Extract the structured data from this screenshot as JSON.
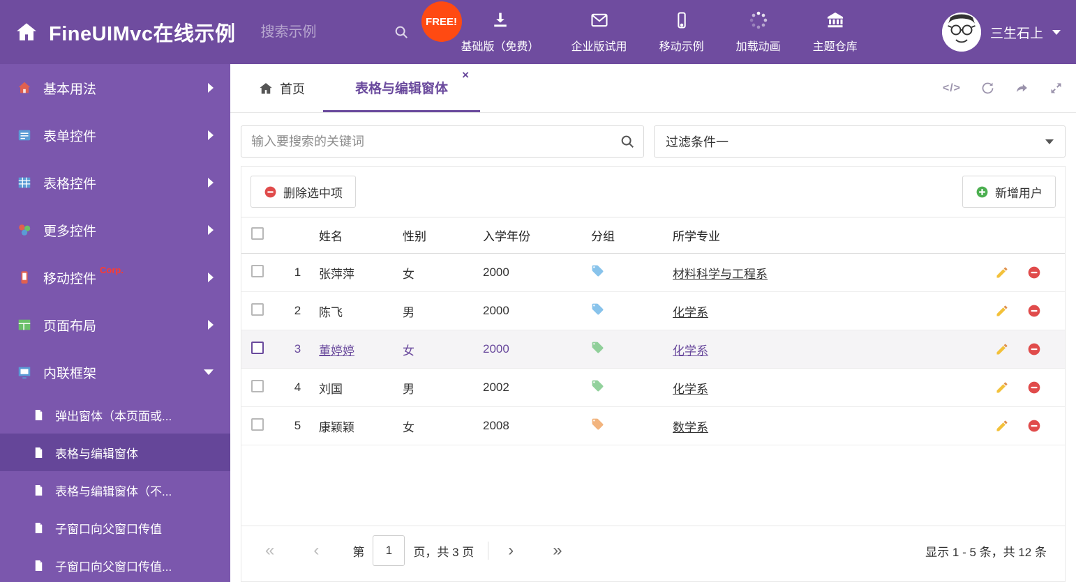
{
  "header": {
    "title": "FineUIMvc在线示例",
    "search_placeholder": "搜索示例",
    "free_badge": "FREE!",
    "nav": [
      {
        "icon": "download-icon",
        "label": "基础版（免费）"
      },
      {
        "icon": "envelope-icon",
        "label": "企业版试用"
      },
      {
        "icon": "mobile-icon",
        "label": "移动示例"
      },
      {
        "icon": "spinner-icon",
        "label": "加载动画"
      },
      {
        "icon": "bank-icon",
        "label": "主题仓库"
      }
    ],
    "user": "三生石上"
  },
  "sidebar": {
    "items": [
      {
        "label": "基本用法"
      },
      {
        "label": "表单控件"
      },
      {
        "label": "表格控件"
      },
      {
        "label": "更多控件"
      },
      {
        "label": "移动控件",
        "badge": "Corp."
      },
      {
        "label": "页面布局"
      },
      {
        "label": "内联框架",
        "expanded": true
      }
    ],
    "subitems": [
      {
        "label": "弹出窗体（本页面或..."
      },
      {
        "label": "表格与编辑窗体",
        "active": true
      },
      {
        "label": "表格与编辑窗体（不..."
      },
      {
        "label": "子窗口向父窗口传值"
      },
      {
        "label": "子窗口向父窗口传值..."
      }
    ]
  },
  "tabs": {
    "home": "首页",
    "active": "表格与编辑窗体"
  },
  "filters": {
    "search_placeholder": "输入要搜索的关键词",
    "dropdown_value": "过滤条件一"
  },
  "toolbar": {
    "delete_label": "删除选中项",
    "add_label": "新增用户"
  },
  "table": {
    "columns": [
      "姓名",
      "性别",
      "入学年份",
      "分组",
      "所学专业"
    ],
    "rows": [
      {
        "num": "1",
        "name": "张萍萍",
        "gender": "女",
        "year": "2000",
        "tag_color": "#74b9e8",
        "major": "材料科学与工程系"
      },
      {
        "num": "2",
        "name": "陈飞",
        "gender": "男",
        "year": "2000",
        "tag_color": "#74b9e8",
        "major": "化学系"
      },
      {
        "num": "3",
        "name": "董婷婷",
        "gender": "女",
        "year": "2000",
        "tag_color": "#7fc98b",
        "major": "化学系",
        "selected": true
      },
      {
        "num": "4",
        "name": "刘国",
        "gender": "男",
        "year": "2002",
        "tag_color": "#7fc98b",
        "major": "化学系"
      },
      {
        "num": "5",
        "name": "康颖颖",
        "gender": "女",
        "year": "2008",
        "tag_color": "#f0a868",
        "major": "数学系"
      }
    ]
  },
  "pagination": {
    "prefix": "第",
    "page_value": "1",
    "suffix": "页，共 3 页",
    "summary": "显示 1 - 5 条，共 12 条"
  },
  "icons": {
    "close": "×",
    "code": "</>",
    "first": "«",
    "prev": "‹",
    "next": "›",
    "last": "»"
  },
  "colors": {
    "header_bg": "#6f4c9f",
    "sidebar_bg": "#7b57ad",
    "sidebar_active_bg": "#654699",
    "accent": "#6a4a9d",
    "free_badge": "#ff4a12",
    "corp_badge": "#ff3b30",
    "delete_red": "#e04b4b",
    "add_green": "#4caf50"
  }
}
